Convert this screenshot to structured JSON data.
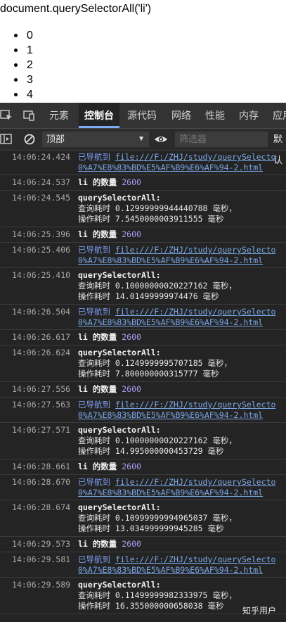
{
  "page": {
    "title": "document.querySelectorAll('li')",
    "items": [
      "0",
      "1",
      "2",
      "3",
      "4"
    ]
  },
  "devtools": {
    "tabs": [
      "元素",
      "控制台",
      "源代码",
      "网络",
      "性能",
      "内存",
      "应用"
    ],
    "active_tab": "控制台",
    "context": "顶部",
    "filter_placeholder": "筛选器",
    "levels": "默认",
    "log": [
      {
        "time": "14:06:24.424",
        "type": "nav",
        "label": "已导航到",
        "link1": "file:///F:/ZHJ/study/querySelecto",
        "link2": "0%A7%E8%83%BD%E5%AF%B9%E6%AF%94-2.html"
      },
      {
        "time": "14:06:24.537",
        "type": "count",
        "label": "li 的数量",
        "value": "2600"
      },
      {
        "time": "14:06:24.545",
        "type": "timing",
        "title": "querySelectorAll:",
        "q": "查询耗时 0.12999999944440788 毫秒，",
        "o": "操作耗时 7.5450000003911555 毫秒"
      },
      {
        "time": "14:06:25.396",
        "type": "count",
        "label": "li 的数量",
        "value": "2600"
      },
      {
        "time": "14:06:25.406",
        "type": "nav",
        "label": "已导航到",
        "link1": "file:///F:/ZHJ/study/querySelecto",
        "link2": "0%A7%E8%83%BD%E5%AF%B9%E6%AF%94-2.html"
      },
      {
        "time": "14:06:25.410",
        "type": "timing",
        "title": "querySelectorAll:",
        "q": "查询耗时 0.10000000020227162 毫秒，",
        "o": "操作耗时 14.01499999974476 毫秒"
      },
      {
        "time": "14:06:26.504",
        "type": "nav",
        "label": "已导航到",
        "link1": "file:///F:/ZHJ/study/querySelecto",
        "link2": "0%A7%E8%83%BD%E5%AF%B9%E6%AF%94-2.html"
      },
      {
        "time": "14:06:26.617",
        "type": "count",
        "label": "li 的数量",
        "value": "2600"
      },
      {
        "time": "14:06:26.624",
        "type": "timing",
        "title": "querySelectorAll:",
        "q": "查询耗时 0.1249999995707185 毫秒，",
        "o": "操作耗时 7.800000000315777 毫秒"
      },
      {
        "time": "14:06:27.556",
        "type": "count",
        "label": "li 的数量",
        "value": "2600"
      },
      {
        "time": "14:06:27.563",
        "type": "nav",
        "label": "已导航到",
        "link1": "file:///F:/ZHJ/study/querySelecto",
        "link2": "0%A7%E8%83%BD%E5%AF%B9%E6%AF%94-2.html"
      },
      {
        "time": "14:06:27.571",
        "type": "timing",
        "title": "querySelectorAll:",
        "q": "查询耗时 0.10000000020227162 毫秒，",
        "o": "操作耗时 14.995000000453729 毫秒"
      },
      {
        "time": "14:06:28.661",
        "type": "count",
        "label": "li 的数量",
        "value": "2600"
      },
      {
        "time": "14:06:28.670",
        "type": "nav",
        "label": "已导航到",
        "link1": "file:///F:/ZHJ/study/querySelecto",
        "link2": "0%A7%E8%83%BD%E5%AF%B9%E6%AF%94-2.html"
      },
      {
        "time": "14:06:28.674",
        "type": "timing",
        "title": "querySelectorAll:",
        "q": "查询耗时 0.10999999994965037 毫秒，",
        "o": "操作耗时 13.034999999945285 毫秒"
      },
      {
        "time": "14:06:29.573",
        "type": "count",
        "label": "li 的数量",
        "value": "2600"
      },
      {
        "time": "14:06:29.581",
        "type": "nav",
        "label": "已导航到",
        "link1": "file:///F:/ZHJ/study/querySelecto",
        "link2": "0%A7%E8%83%BD%E5%AF%B9%E6%AF%94-2.html"
      },
      {
        "time": "14:06:29.589",
        "type": "timing",
        "title": "querySelectorAll:",
        "q": "查询耗时 0.11499999982333975 毫秒，",
        "o": "操作耗时 16.355000000658038 毫秒"
      }
    ]
  },
  "watermark": "知乎用户"
}
